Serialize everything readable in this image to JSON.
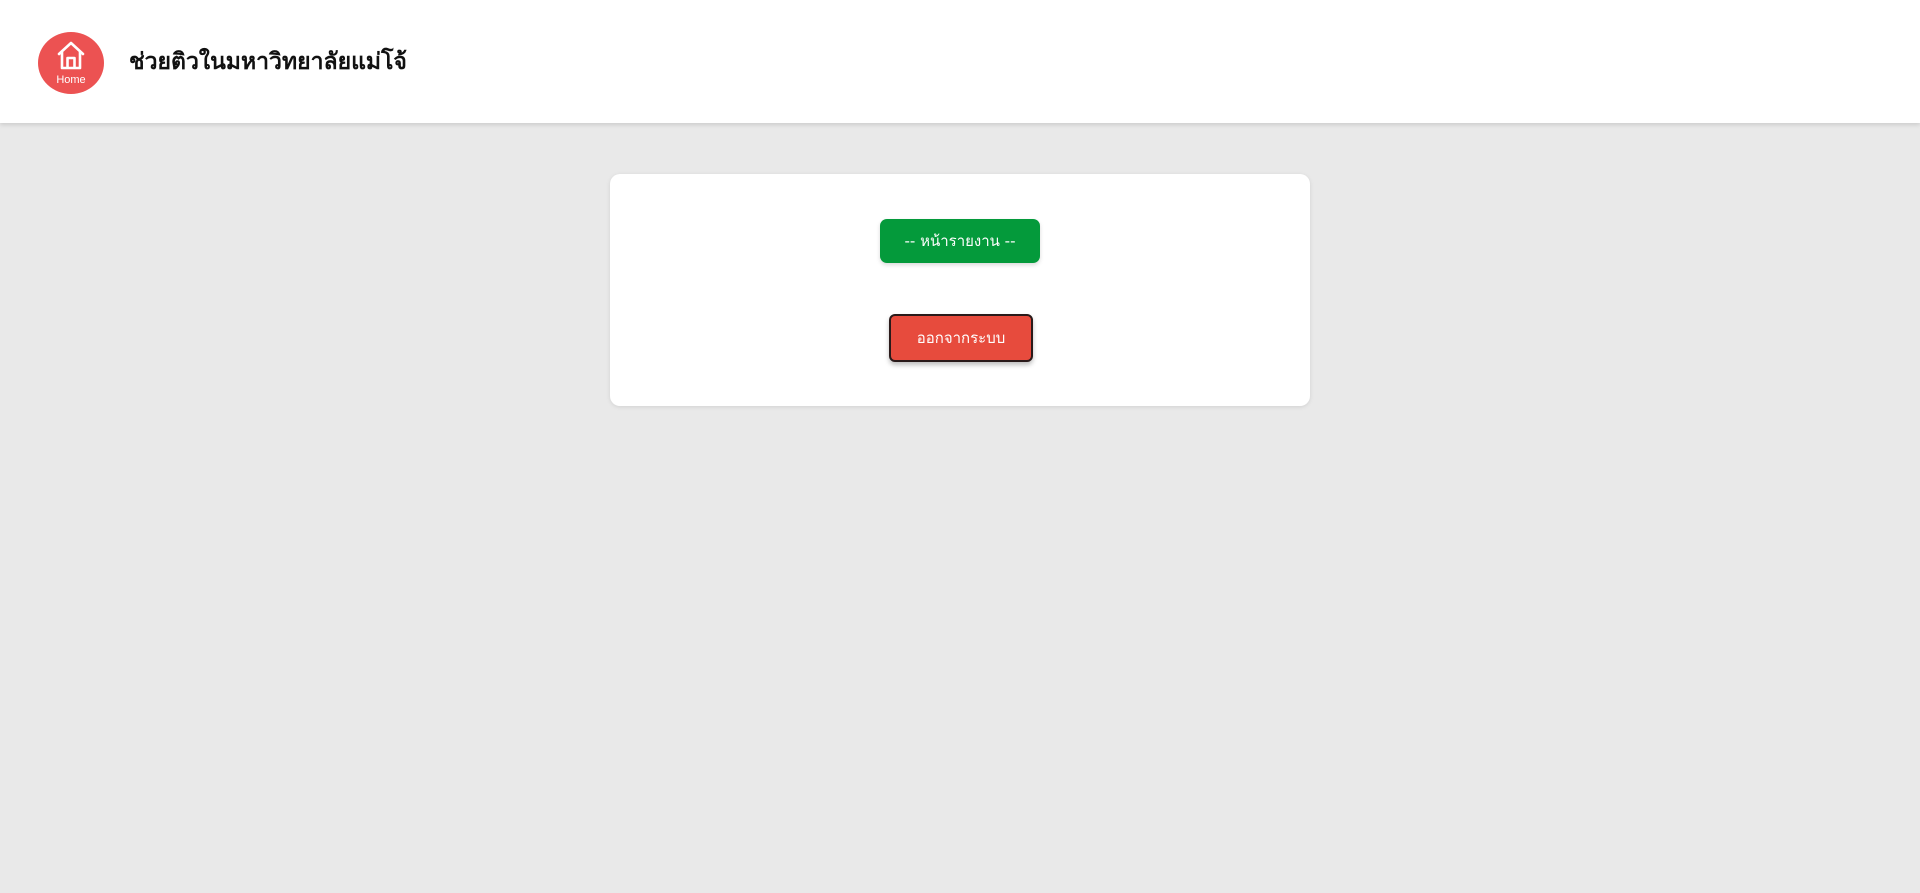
{
  "header": {
    "home_icon": "home-icon",
    "home_label": "Home",
    "title": "ช่วยติวในมหาวิทยาลัยแม่โจ้"
  },
  "main": {
    "report_button_label": "-- หน้ารายงาน --",
    "logout_button_label": "ออกจากระบบ"
  },
  "colors": {
    "background": "#e9e9e9",
    "home_button": "#ec5252",
    "report_button": "#049a3b",
    "logout_button": "#e74b3d"
  }
}
